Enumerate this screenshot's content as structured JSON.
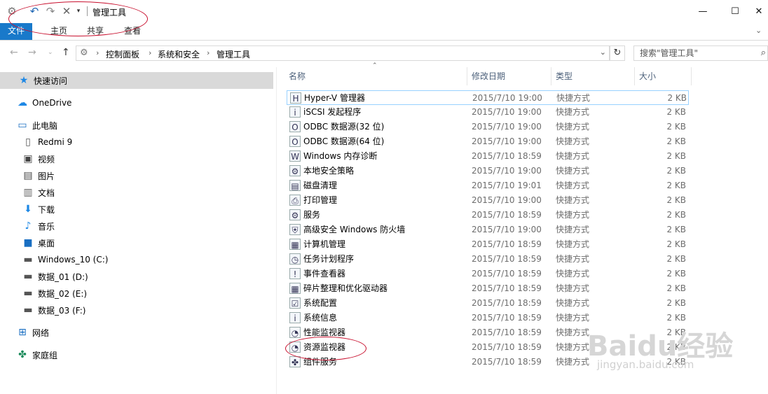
{
  "window": {
    "title": "管理工具",
    "controls": {
      "minimize": "—",
      "maximize": "☐",
      "close": "✕"
    }
  },
  "quick_access_toolbar": {
    "properties_icon": "properties-icon",
    "undo_icon": "undo-icon",
    "redo_icon": "redo-icon",
    "delete_icon": "delete-icon",
    "customize_icon": "dropdown-icon"
  },
  "ribbon": {
    "tabs": [
      {
        "label": "文件"
      },
      {
        "label": "主页"
      },
      {
        "label": "共享"
      },
      {
        "label": "查看"
      }
    ]
  },
  "address_bar": {
    "breadcrumbs": [
      "控制面板",
      "系统和安全",
      "管理工具"
    ],
    "search_placeholder": "搜索\"管理工具\""
  },
  "nav_pane": {
    "items": [
      {
        "label": "快速访问",
        "icon": "star-icon",
        "color": "#1e88e5"
      },
      {
        "label": "OneDrive",
        "icon": "cloud-icon",
        "color": "#1e88e5"
      },
      {
        "label": "此电脑",
        "icon": "computer-icon",
        "color": "#1a6fc2"
      },
      {
        "label": "Redmi 9",
        "icon": "phone-icon",
        "color": "#555555"
      },
      {
        "label": "视频",
        "icon": "video-icon",
        "color": "#444444"
      },
      {
        "label": "图片",
        "icon": "picture-icon",
        "color": "#444444"
      },
      {
        "label": "文档",
        "icon": "document-icon",
        "color": "#666666"
      },
      {
        "label": "下载",
        "icon": "download-icon",
        "color": "#1e88e5"
      },
      {
        "label": "音乐",
        "icon": "music-icon",
        "color": "#1e88e5"
      },
      {
        "label": "桌面",
        "icon": "desktop-icon",
        "color": "#1a6fc2"
      },
      {
        "label": "Windows_10 (C:)",
        "icon": "drive-icon",
        "color": "#555555"
      },
      {
        "label": "数据_01 (D:)",
        "icon": "drive-icon",
        "color": "#555555"
      },
      {
        "label": "数据_02 (E:)",
        "icon": "drive-icon",
        "color": "#555555"
      },
      {
        "label": "数据_03 (F:)",
        "icon": "drive-icon",
        "color": "#555555"
      },
      {
        "label": "网络",
        "icon": "network-icon",
        "color": "#1a6fc2"
      },
      {
        "label": "家庭组",
        "icon": "homegroup-icon",
        "color": "#1a8a5a"
      }
    ]
  },
  "file_list": {
    "columns": {
      "name": "名称",
      "date": "修改日期",
      "type": "类型",
      "size": "大小"
    },
    "rows": [
      {
        "name": "Hyper-V 管理器",
        "date": "2015/7/10 19:00",
        "type": "快捷方式",
        "size": "2 KB"
      },
      {
        "name": "iSCSI 发起程序",
        "date": "2015/7/10 19:00",
        "type": "快捷方式",
        "size": "2 KB"
      },
      {
        "name": "ODBC 数据源(32 位)",
        "date": "2015/7/10 19:00",
        "type": "快捷方式",
        "size": "2 KB"
      },
      {
        "name": "ODBC 数据源(64 位)",
        "date": "2015/7/10 19:00",
        "type": "快捷方式",
        "size": "2 KB"
      },
      {
        "name": "Windows 内存诊断",
        "date": "2015/7/10 18:59",
        "type": "快捷方式",
        "size": "2 KB"
      },
      {
        "name": "本地安全策略",
        "date": "2015/7/10 19:00",
        "type": "快捷方式",
        "size": "2 KB"
      },
      {
        "name": "磁盘清理",
        "date": "2015/7/10 19:01",
        "type": "快捷方式",
        "size": "2 KB"
      },
      {
        "name": "打印管理",
        "date": "2015/7/10 19:00",
        "type": "快捷方式",
        "size": "2 KB"
      },
      {
        "name": "服务",
        "date": "2015/7/10 18:59",
        "type": "快捷方式",
        "size": "2 KB"
      },
      {
        "name": "高级安全 Windows 防火墙",
        "date": "2015/7/10 19:00",
        "type": "快捷方式",
        "size": "2 KB"
      },
      {
        "name": "计算机管理",
        "date": "2015/7/10 18:59",
        "type": "快捷方式",
        "size": "2 KB"
      },
      {
        "name": "任务计划程序",
        "date": "2015/7/10 18:59",
        "type": "快捷方式",
        "size": "2 KB"
      },
      {
        "name": "事件查看器",
        "date": "2015/7/10 18:59",
        "type": "快捷方式",
        "size": "2 KB"
      },
      {
        "name": "碎片整理和优化驱动器",
        "date": "2015/7/10 18:59",
        "type": "快捷方式",
        "size": "2 KB"
      },
      {
        "name": "系统配置",
        "date": "2015/7/10 18:59",
        "type": "快捷方式",
        "size": "2 KB"
      },
      {
        "name": "系统信息",
        "date": "2015/7/10 18:59",
        "type": "快捷方式",
        "size": "2 KB"
      },
      {
        "name": "性能监视器",
        "date": "2015/7/10 18:59",
        "type": "快捷方式",
        "size": "2 KB"
      },
      {
        "name": "资源监视器",
        "date": "2015/7/10 18:59",
        "type": "快捷方式",
        "size": "2 KB"
      },
      {
        "name": "组件服务",
        "date": "2015/7/10 18:59",
        "type": "快捷方式",
        "size": "2 KB"
      }
    ]
  },
  "watermark": {
    "text": "Baidu经验",
    "sub": "jingyan.baidu.com"
  },
  "colors": {
    "accent": "#1979ca",
    "annotation": "#c8102e",
    "selection_border": "#99d1ff"
  }
}
